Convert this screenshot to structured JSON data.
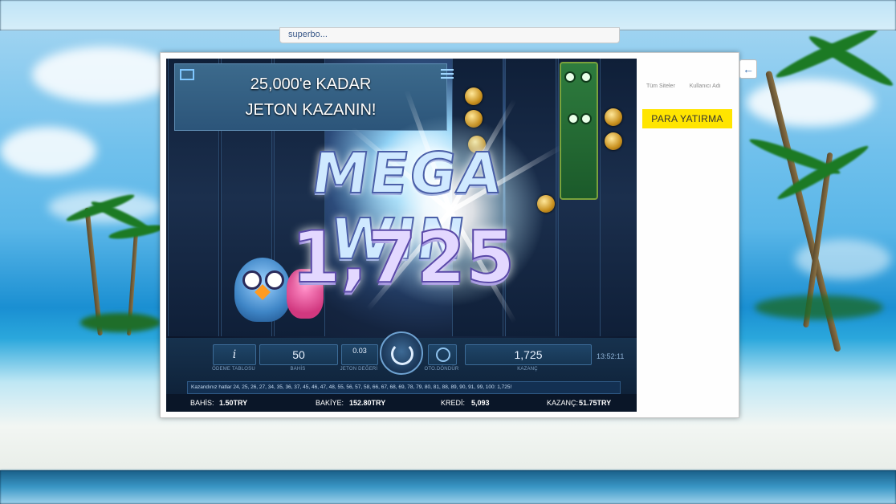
{
  "browser": {
    "url_fragment": "superbo..."
  },
  "site": {
    "links": [
      "Tüm Siteler",
      "Kullanıcı Adı"
    ],
    "deposit_button": "PARA YATIRMA",
    "back_icon": "arrow-left-icon"
  },
  "game": {
    "promo_line1": "25,000'e KADAR",
    "promo_line2": "JETON KAZANIN!",
    "mega_text": "MEGA WIN",
    "big_amount": "1,725",
    "controls": {
      "info_symbol": "i",
      "info_caption": "ÖDEME TABLOSU",
      "bet_value": "50",
      "bet_caption": "BAHİS",
      "coin_value": "0.03",
      "coin_caption": "JETON DEĞERİ",
      "autoplay_caption": "OTO.DÖNDÜR",
      "win_value": "1,725",
      "win_caption": "KAZANÇ",
      "time": "13:52:11"
    },
    "won_lines": "Kazandınız hatlar 24, 25, 26, 27, 34, 35, 36, 37, 45, 46, 47, 48, 55, 56, 57, 58, 66, 67, 68, 69, 78, 79, 80, 81, 88, 89, 90, 91, 99, 100: 1,725!",
    "status": {
      "bet_label": "BAHİS:",
      "bet_value": "1.50TRY",
      "balance_label": "BAKİYE:",
      "balance_value": "152.80TRY",
      "credit_label": "KREDİ:",
      "credit_value": "5,093",
      "win_label": "KAZANÇ:",
      "win_value": "51.75TRY"
    }
  }
}
